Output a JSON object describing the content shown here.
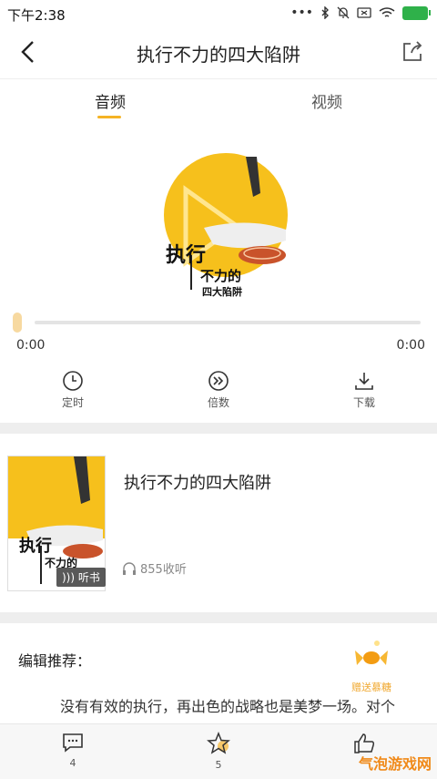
{
  "status_bar": {
    "time": "下午2:38",
    "icons": [
      "dots-icon",
      "bluetooth-icon",
      "mute-icon",
      "sim-icon",
      "wifi-icon",
      "battery-icon"
    ]
  },
  "nav": {
    "title": "执行不力的四大陷阱"
  },
  "tabs": [
    {
      "label": "音频",
      "active": true
    },
    {
      "label": "视频",
      "active": false
    }
  ],
  "cover": {
    "line1": "执行",
    "line2": "不力的",
    "line3": "四大陷阱"
  },
  "player": {
    "current_time": "0:00",
    "total_time": "0:00",
    "progress": 0
  },
  "controls": [
    {
      "label": "定时",
      "icon": "clock-icon"
    },
    {
      "label": "倍数",
      "icon": "speed-icon"
    },
    {
      "label": "下载",
      "icon": "download-icon"
    }
  ],
  "book": {
    "title": "执行不力的四大陷阱",
    "listen_count": "855收听",
    "badge": "听书"
  },
  "editor": {
    "heading": "编辑推荐：",
    "text": "没有有效的执行，再出色的战略也是美梦一场。对个",
    "gift_label": "赠送慕糖"
  },
  "bottom_bar": {
    "comments": "4",
    "favorites": "5"
  },
  "watermark": "气泡游戏网",
  "colors": {
    "accent": "#f5b324",
    "cover_yellow": "#f6c01c"
  }
}
